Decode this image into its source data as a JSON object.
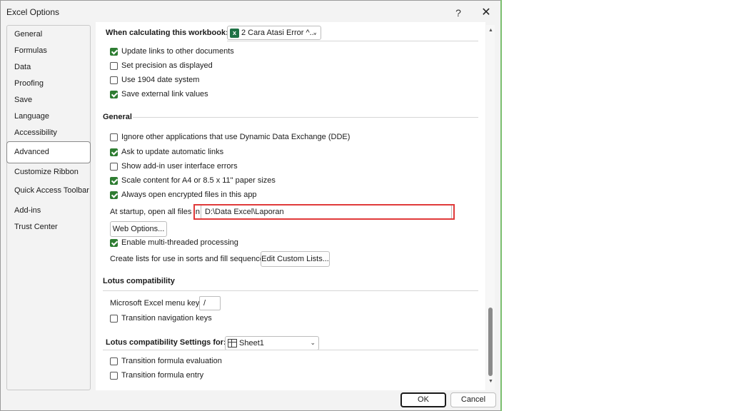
{
  "window": {
    "title": "Excel Options",
    "help_glyph": "?",
    "close_glyph": "✕"
  },
  "sidebar": {
    "items": [
      {
        "label": "General"
      },
      {
        "label": "Formulas"
      },
      {
        "label": "Data"
      },
      {
        "label": "Proofing"
      },
      {
        "label": "Save"
      },
      {
        "label": "Language"
      },
      {
        "label": "Accessibility"
      },
      {
        "label": "Advanced",
        "active": true
      },
      {
        "label": "Customize Ribbon"
      },
      {
        "label": "Quick Access Toolbar"
      },
      {
        "label": "Add-ins"
      },
      {
        "label": "Trust Center"
      }
    ]
  },
  "workbook_calc": {
    "heading": "When calculating this workbook:",
    "selected_workbook": "2 Cara Atasi Error ^...",
    "options": [
      {
        "label": "Update links to other documents",
        "checked": true
      },
      {
        "label": "Set precision as displayed",
        "checked": false
      },
      {
        "label": "Use 1904 date system",
        "checked": false
      },
      {
        "label": "Save external link values",
        "checked": true
      }
    ]
  },
  "general": {
    "heading": "General",
    "options": [
      {
        "label": "Ignore other applications that use Dynamic Data Exchange (DDE)",
        "checked": false
      },
      {
        "label": "Ask to update automatic links",
        "checked": true
      },
      {
        "label": "Show add-in user interface errors",
        "checked": false
      },
      {
        "label": "Scale content for A4 or 8.5 x 11\" paper sizes",
        "checked": true
      },
      {
        "label": "Always open encrypted files in this app",
        "checked": true
      }
    ],
    "startup_label": "At startup, open all files in:",
    "startup_value": "D:\\Data Excel\\Laporan",
    "web_options_label": "Web Options...",
    "multithread": {
      "label": "Enable multi-threaded processing",
      "checked": true
    },
    "sort_lists_label": "Create lists for use in sorts and fill sequences:",
    "edit_lists_label": "Edit Custom Lists..."
  },
  "lotus": {
    "heading": "Lotus compatibility",
    "menu_key_label": "Microsoft Excel menu key:",
    "menu_key_value": "/",
    "nav_keys": {
      "label": "Transition navigation keys",
      "checked": false
    }
  },
  "lotus_settings": {
    "heading": "Lotus compatibility Settings for:",
    "selected_sheet": "Sheet1",
    "options": [
      {
        "label": "Transition formula evaluation",
        "checked": false
      },
      {
        "label": "Transition formula entry",
        "checked": false
      }
    ]
  },
  "footer": {
    "ok_label": "OK",
    "cancel_label": "Cancel"
  },
  "colors": {
    "accent_check": "#2e7d32",
    "highlight_border": "#e03a3a",
    "excel_green": "#1e7145"
  }
}
